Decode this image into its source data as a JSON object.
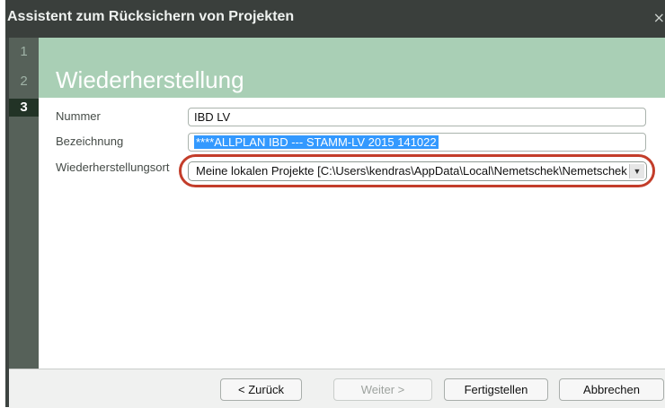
{
  "window": {
    "title": "Assistent zum Rücksichern von Projekten",
    "close_glyph": "×"
  },
  "steps": [
    "1",
    "2",
    "3"
  ],
  "current_step": "3",
  "header": {
    "title": "Wiederherstellung"
  },
  "form": {
    "nummer_label": "Nummer",
    "nummer_value": "IBD LV",
    "bezeichnung_label": "Bezeichnung",
    "bezeichnung_value": "****ALLPLAN IBD --- STAMM-LV 2015 141022",
    "ort_label": "Wiederherstellungsort",
    "ort_value": "Meine lokalen Projekte [C:\\Users\\kendras\\AppData\\Local\\Nemetschek\\Nemetschek",
    "ort_dropdown_icon": "chevron-down-icon"
  },
  "buttons": {
    "back": "< Zurück",
    "next": "Weiter >",
    "finish": "Fertigstellen",
    "cancel": "Abbrechen"
  },
  "colors": {
    "header_bg": "#a9cfb5",
    "step_active": "#223326",
    "highlight_oval": "#c33d2a",
    "selection": "#3399ff"
  }
}
